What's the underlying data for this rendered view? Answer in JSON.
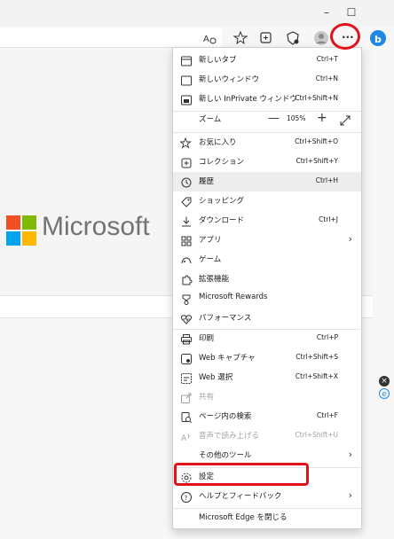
{
  "window": {
    "minimize_glyph": "–",
    "maximize_glyph": "☐"
  },
  "toolbar": {
    "icons": [
      "read-aloud-icon",
      "favorites-icon",
      "collections-icon",
      "browser-essentials-icon",
      "profile-icon",
      "settings-more-icon",
      "bing-icon"
    ],
    "more_glyph": "···"
  },
  "page": {
    "logo_text": "Microsoft"
  },
  "menu": {
    "items": [
      {
        "icon": "new-tab-icon",
        "label": "新しいタブ",
        "shortcut": "Ctrl+T"
      },
      {
        "icon": "new-window-icon",
        "label": "新しいウィンドウ",
        "shortcut": "Ctrl+N"
      },
      {
        "icon": "inprivate-icon",
        "label": "新しい InPrivate ウィンドウ",
        "shortcut": "Ctrl+Shift+N"
      },
      {
        "label": "ズーム",
        "zoom_value": "105%",
        "minus": "—",
        "plus": "+"
      },
      {
        "icon": "favorites-icon",
        "label": "お気に入り",
        "shortcut": "Ctrl+Shift+O"
      },
      {
        "icon": "collections-icon",
        "label": "コレクション",
        "shortcut": "Ctrl+Shift+Y"
      },
      {
        "icon": "history-icon",
        "label": "履歴",
        "shortcut": "Ctrl+H"
      },
      {
        "icon": "shopping-icon",
        "label": "ショッピング"
      },
      {
        "icon": "download-icon",
        "label": "ダウンロード",
        "shortcut": "Ctrl+J"
      },
      {
        "icon": "apps-icon",
        "label": "アプリ"
      },
      {
        "icon": "games-icon",
        "label": "ゲーム"
      },
      {
        "icon": "extensions-icon",
        "label": "拡張機能"
      },
      {
        "icon": "rewards-icon",
        "label": "Microsoft Rewards"
      },
      {
        "icon": "performance-icon",
        "label": "パフォーマンス"
      },
      {
        "icon": "print-icon",
        "label": "印刷",
        "shortcut": "Ctrl+P"
      },
      {
        "icon": "web-capture-icon",
        "label": "Web キャプチャ",
        "shortcut": "Ctrl+Shift+S"
      },
      {
        "icon": "web-select-icon",
        "label": "Web 選択",
        "shortcut": "Ctrl+Shift+X"
      },
      {
        "icon": "share-icon",
        "label": "共有"
      },
      {
        "icon": "find-icon",
        "label": "ページ内の検索",
        "shortcut": "Ctrl+F"
      },
      {
        "icon": "read-aloud-icon",
        "label": "音声で読み上げる",
        "shortcut": "Ctrl+Shift+U"
      },
      {
        "label": "その他のツール"
      },
      {
        "icon": "settings-icon",
        "label": "設定"
      },
      {
        "icon": "help-icon",
        "label": "ヘルプとフィードバック"
      },
      {
        "label": "Microsoft Edge を閉じる"
      }
    ],
    "arrow_glyph": "›"
  },
  "colors": {
    "highlight": "#e1121a",
    "menu_hover": "#ededed",
    "disabled_text": "#a0a0a0"
  }
}
